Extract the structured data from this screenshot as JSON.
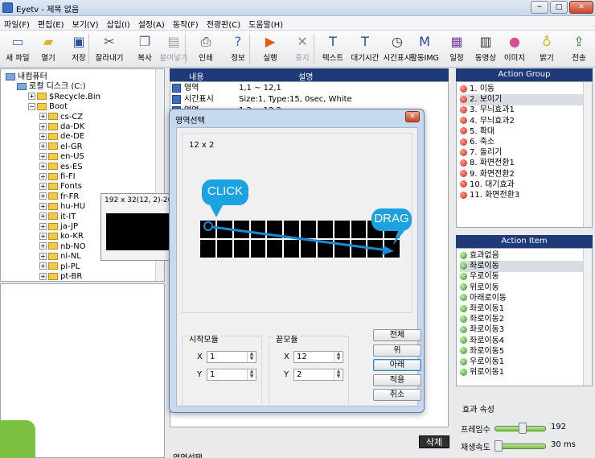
{
  "window": {
    "title": "Eyetv - 제목 없음"
  },
  "menu": [
    "파일(F)",
    "편집(E)",
    "보기(V)",
    "삽입(I)",
    "설정(A)",
    "동작(F)",
    "전광판(C)",
    "도움말(H)"
  ],
  "toolbar": [
    {
      "label": "새 파일",
      "icon": "new-file-icon",
      "glyph": "▭",
      "color": "#4f6fa8"
    },
    {
      "label": "열기",
      "icon": "open-folder-icon",
      "glyph": "▰",
      "color": "#e0b028"
    },
    {
      "label": "저장",
      "icon": "save-icon",
      "glyph": "▣",
      "color": "#2b4f9c"
    },
    {
      "label": "잘라내기",
      "icon": "scissors-icon",
      "glyph": "✂",
      "color": "#555"
    },
    {
      "label": "복사",
      "icon": "copy-icon",
      "glyph": "❐",
      "color": "#5a6d8a"
    },
    {
      "label": "붙여넣기",
      "icon": "paste-icon",
      "glyph": "▤",
      "color": "#9aa0a6",
      "disabled": true
    },
    {
      "label": "인쇄",
      "icon": "print-icon",
      "glyph": "⎙",
      "color": "#444"
    },
    {
      "label": "정보",
      "icon": "info-icon",
      "glyph": "?",
      "color": "#2a66c8"
    },
    {
      "label": "실행",
      "icon": "play-icon",
      "glyph": "▶",
      "color": "#e25b10"
    },
    {
      "label": "중지",
      "icon": "stop-icon",
      "glyph": "✕",
      "color": "#888",
      "disabled": true
    },
    {
      "label": "텍스트",
      "icon": "text-icon",
      "glyph": "T",
      "color": "#2a4fa0"
    },
    {
      "label": "대기시간",
      "icon": "wait-time-icon",
      "glyph": "T",
      "color": "#2a4fa0"
    },
    {
      "label": "시간표시",
      "icon": "clock-icon",
      "glyph": "◷",
      "color": "#333"
    },
    {
      "label": "활동IMG",
      "icon": "image-icon",
      "glyph": "M",
      "color": "#2a3fa0"
    },
    {
      "label": "일정",
      "icon": "schedule-icon",
      "glyph": "▦",
      "color": "#7a3ea8"
    },
    {
      "label": "동영상",
      "icon": "film-icon",
      "glyph": "▥",
      "color": "#333"
    },
    {
      "label": "이미지",
      "icon": "palette-icon",
      "glyph": "●",
      "color": "#d64d8f"
    },
    {
      "label": "밝기",
      "icon": "bulb-icon",
      "glyph": "♁",
      "color": "#e0b028"
    },
    {
      "label": "전송",
      "icon": "transfer-icon",
      "glyph": "⇪",
      "color": "#2e7a3c"
    }
  ],
  "tree": [
    {
      "label": "내컴퓨터",
      "level": 0,
      "type": "computer"
    },
    {
      "label": "로컬 디스크 (C:)",
      "level": 1,
      "type": "drive"
    },
    {
      "label": "$Recycle.Bin",
      "level": 2,
      "type": "folder"
    },
    {
      "label": "Boot",
      "level": 2,
      "type": "folder"
    },
    {
      "label": "cs-CZ",
      "level": 3,
      "type": "folder"
    },
    {
      "label": "da-DK",
      "level": 3,
      "type": "folder"
    },
    {
      "label": "de-DE",
      "level": 3,
      "type": "folder"
    },
    {
      "label": "el-GR",
      "level": 3,
      "type": "folder"
    },
    {
      "label": "en-US",
      "level": 3,
      "type": "folder"
    },
    {
      "label": "es-ES",
      "level": 3,
      "type": "folder"
    },
    {
      "label": "fi-FI",
      "level": 3,
      "type": "folder"
    },
    {
      "label": "Fonts",
      "level": 3,
      "type": "folder"
    },
    {
      "label": "fr-FR",
      "level": 3,
      "type": "folder"
    },
    {
      "label": "hu-HU",
      "level": 3,
      "type": "folder"
    },
    {
      "label": "it-IT",
      "level": 3,
      "type": "folder"
    },
    {
      "label": "ja-JP",
      "level": 3,
      "type": "folder"
    },
    {
      "label": "ko-KR",
      "level": 3,
      "type": "folder"
    },
    {
      "label": "nb-NO",
      "level": 3,
      "type": "folder"
    },
    {
      "label": "nl-NL",
      "level": 3,
      "type": "folder"
    },
    {
      "label": "pl-PL",
      "level": 3,
      "type": "folder"
    },
    {
      "label": "pt-BR",
      "level": 3,
      "type": "folder"
    }
  ],
  "preview_popup": {
    "title": "192 x 32(12, 2)-200%"
  },
  "center": {
    "col_content": "내용",
    "col_desc": "설명",
    "rows": [
      {
        "name": "영역",
        "desc": "1,1 ~ 12,1"
      },
      {
        "name": "시간표시",
        "desc": "Size:1, Type:15, 0sec, White"
      },
      {
        "name": "영역",
        "desc": "1,2 ~ 12,2"
      }
    ],
    "delete_label": "삭제",
    "bottom_label": "영역선택"
  },
  "dialog": {
    "title": "영역선택",
    "size_label": "12 x 2",
    "grid": {
      "cols": 12,
      "rows": 2
    },
    "click_label": "CLICK",
    "drag_label": "DRAG",
    "start_group": "시작모듈",
    "end_group": "끝모듈",
    "x_label": "X",
    "y_label": "Y",
    "start": {
      "x": "1",
      "y": "1"
    },
    "end": {
      "x": "12",
      "y": "2"
    },
    "buttons": [
      "전체",
      "위",
      "아래",
      "적용",
      "취소"
    ]
  },
  "action_group": {
    "title": "Action Group",
    "items": [
      "1. 이동",
      "2. 보이기",
      "3. 무늬효과1",
      "4. 무늬효과2",
      "5. 확대",
      "6. 축소",
      "7. 돌리기",
      "8. 화면전환1",
      "9. 화면전환2",
      "10. 대기효과",
      "11. 화면전환3"
    ],
    "selected": 1
  },
  "action_item": {
    "title": "Action Item",
    "items": [
      "효과없음",
      "좌로이동",
      "우로이동",
      "위로이동",
      "아래로이동",
      "좌로이동1",
      "좌로이동2",
      "좌로이동3",
      "좌로이동4",
      "좌로이동5",
      "우로이동1",
      "위로이동1"
    ],
    "selected": 1
  },
  "effect_props": {
    "title": "효과 속성",
    "frame_label": "프레임수",
    "frame_value": "192",
    "frame_fraction": 0.55,
    "speed_label": "재생속도",
    "speed_value": "30 ms",
    "speed_fraction": 0.08
  },
  "colors": {
    "accent": "#1e3a78",
    "bubble": "#1aa3e0",
    "arrow": "#1a8ad4"
  }
}
